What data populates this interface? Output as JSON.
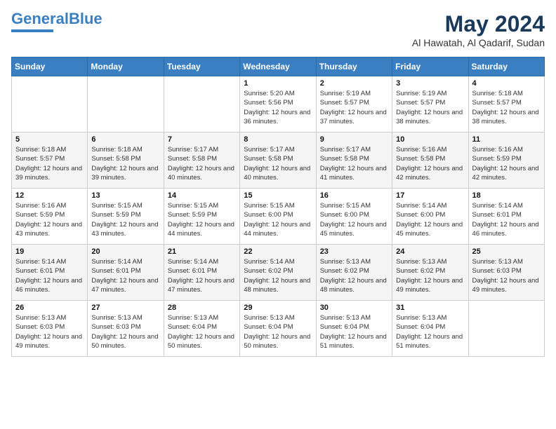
{
  "logo": {
    "line1": "General",
    "line2": "Blue"
  },
  "title": "May 2024",
  "location": "Al Hawatah, Al Qadarif, Sudan",
  "weekdays": [
    "Sunday",
    "Monday",
    "Tuesday",
    "Wednesday",
    "Thursday",
    "Friday",
    "Saturday"
  ],
  "weeks": [
    [
      {
        "day": "",
        "sunrise": "",
        "sunset": "",
        "daylight": ""
      },
      {
        "day": "",
        "sunrise": "",
        "sunset": "",
        "daylight": ""
      },
      {
        "day": "",
        "sunrise": "",
        "sunset": "",
        "daylight": ""
      },
      {
        "day": "1",
        "sunrise": "Sunrise: 5:20 AM",
        "sunset": "Sunset: 5:56 PM",
        "daylight": "Daylight: 12 hours and 36 minutes."
      },
      {
        "day": "2",
        "sunrise": "Sunrise: 5:19 AM",
        "sunset": "Sunset: 5:57 PM",
        "daylight": "Daylight: 12 hours and 37 minutes."
      },
      {
        "day": "3",
        "sunrise": "Sunrise: 5:19 AM",
        "sunset": "Sunset: 5:57 PM",
        "daylight": "Daylight: 12 hours and 38 minutes."
      },
      {
        "day": "4",
        "sunrise": "Sunrise: 5:18 AM",
        "sunset": "Sunset: 5:57 PM",
        "daylight": "Daylight: 12 hours and 38 minutes."
      }
    ],
    [
      {
        "day": "5",
        "sunrise": "Sunrise: 5:18 AM",
        "sunset": "Sunset: 5:57 PM",
        "daylight": "Daylight: 12 hours and 39 minutes."
      },
      {
        "day": "6",
        "sunrise": "Sunrise: 5:18 AM",
        "sunset": "Sunset: 5:58 PM",
        "daylight": "Daylight: 12 hours and 39 minutes."
      },
      {
        "day": "7",
        "sunrise": "Sunrise: 5:17 AM",
        "sunset": "Sunset: 5:58 PM",
        "daylight": "Daylight: 12 hours and 40 minutes."
      },
      {
        "day": "8",
        "sunrise": "Sunrise: 5:17 AM",
        "sunset": "Sunset: 5:58 PM",
        "daylight": "Daylight: 12 hours and 40 minutes."
      },
      {
        "day": "9",
        "sunrise": "Sunrise: 5:17 AM",
        "sunset": "Sunset: 5:58 PM",
        "daylight": "Daylight: 12 hours and 41 minutes."
      },
      {
        "day": "10",
        "sunrise": "Sunrise: 5:16 AM",
        "sunset": "Sunset: 5:58 PM",
        "daylight": "Daylight: 12 hours and 42 minutes."
      },
      {
        "day": "11",
        "sunrise": "Sunrise: 5:16 AM",
        "sunset": "Sunset: 5:59 PM",
        "daylight": "Daylight: 12 hours and 42 minutes."
      }
    ],
    [
      {
        "day": "12",
        "sunrise": "Sunrise: 5:16 AM",
        "sunset": "Sunset: 5:59 PM",
        "daylight": "Daylight: 12 hours and 43 minutes."
      },
      {
        "day": "13",
        "sunrise": "Sunrise: 5:15 AM",
        "sunset": "Sunset: 5:59 PM",
        "daylight": "Daylight: 12 hours and 43 minutes."
      },
      {
        "day": "14",
        "sunrise": "Sunrise: 5:15 AM",
        "sunset": "Sunset: 5:59 PM",
        "daylight": "Daylight: 12 hours and 44 minutes."
      },
      {
        "day": "15",
        "sunrise": "Sunrise: 5:15 AM",
        "sunset": "Sunset: 6:00 PM",
        "daylight": "Daylight: 12 hours and 44 minutes."
      },
      {
        "day": "16",
        "sunrise": "Sunrise: 5:15 AM",
        "sunset": "Sunset: 6:00 PM",
        "daylight": "Daylight: 12 hours and 45 minutes."
      },
      {
        "day": "17",
        "sunrise": "Sunrise: 5:14 AM",
        "sunset": "Sunset: 6:00 PM",
        "daylight": "Daylight: 12 hours and 45 minutes."
      },
      {
        "day": "18",
        "sunrise": "Sunrise: 5:14 AM",
        "sunset": "Sunset: 6:01 PM",
        "daylight": "Daylight: 12 hours and 46 minutes."
      }
    ],
    [
      {
        "day": "19",
        "sunrise": "Sunrise: 5:14 AM",
        "sunset": "Sunset: 6:01 PM",
        "daylight": "Daylight: 12 hours and 46 minutes."
      },
      {
        "day": "20",
        "sunrise": "Sunrise: 5:14 AM",
        "sunset": "Sunset: 6:01 PM",
        "daylight": "Daylight: 12 hours and 47 minutes."
      },
      {
        "day": "21",
        "sunrise": "Sunrise: 5:14 AM",
        "sunset": "Sunset: 6:01 PM",
        "daylight": "Daylight: 12 hours and 47 minutes."
      },
      {
        "day": "22",
        "sunrise": "Sunrise: 5:14 AM",
        "sunset": "Sunset: 6:02 PM",
        "daylight": "Daylight: 12 hours and 48 minutes."
      },
      {
        "day": "23",
        "sunrise": "Sunrise: 5:13 AM",
        "sunset": "Sunset: 6:02 PM",
        "daylight": "Daylight: 12 hours and 48 minutes."
      },
      {
        "day": "24",
        "sunrise": "Sunrise: 5:13 AM",
        "sunset": "Sunset: 6:02 PM",
        "daylight": "Daylight: 12 hours and 49 minutes."
      },
      {
        "day": "25",
        "sunrise": "Sunrise: 5:13 AM",
        "sunset": "Sunset: 6:03 PM",
        "daylight": "Daylight: 12 hours and 49 minutes."
      }
    ],
    [
      {
        "day": "26",
        "sunrise": "Sunrise: 5:13 AM",
        "sunset": "Sunset: 6:03 PM",
        "daylight": "Daylight: 12 hours and 49 minutes."
      },
      {
        "day": "27",
        "sunrise": "Sunrise: 5:13 AM",
        "sunset": "Sunset: 6:03 PM",
        "daylight": "Daylight: 12 hours and 50 minutes."
      },
      {
        "day": "28",
        "sunrise": "Sunrise: 5:13 AM",
        "sunset": "Sunset: 6:04 PM",
        "daylight": "Daylight: 12 hours and 50 minutes."
      },
      {
        "day": "29",
        "sunrise": "Sunrise: 5:13 AM",
        "sunset": "Sunset: 6:04 PM",
        "daylight": "Daylight: 12 hours and 50 minutes."
      },
      {
        "day": "30",
        "sunrise": "Sunrise: 5:13 AM",
        "sunset": "Sunset: 6:04 PM",
        "daylight": "Daylight: 12 hours and 51 minutes."
      },
      {
        "day": "31",
        "sunrise": "Sunrise: 5:13 AM",
        "sunset": "Sunset: 6:04 PM",
        "daylight": "Daylight: 12 hours and 51 minutes."
      },
      {
        "day": "",
        "sunrise": "",
        "sunset": "",
        "daylight": ""
      }
    ]
  ]
}
